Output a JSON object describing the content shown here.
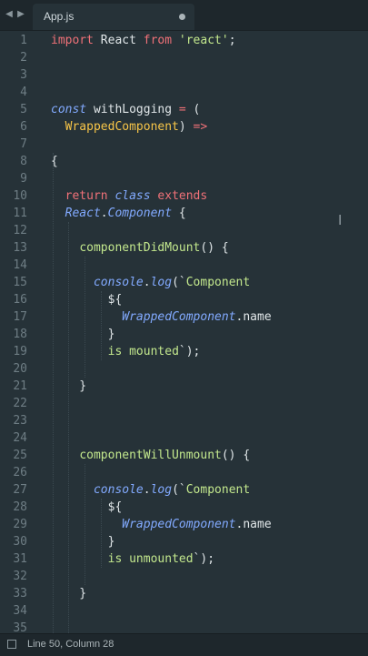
{
  "tabbar": {
    "back_icon": "triangle-left",
    "forward_icon": "triangle-right",
    "active_tab": {
      "label": "App.js",
      "modified_indicator": "dot"
    }
  },
  "editor": {
    "lines": [
      {
        "n": "1",
        "tokens": [
          {
            "t": "import",
            "c": "kw"
          },
          {
            "t": " React ",
            "c": "plain"
          },
          {
            "t": "from",
            "c": "kw"
          },
          {
            "t": " ",
            "c": "plain"
          },
          {
            "t": "'react'",
            "c": "str"
          },
          {
            "t": ";",
            "c": "punc"
          }
        ]
      },
      {
        "n": "2",
        "tokens": []
      },
      {
        "n": "3",
        "tokens": []
      },
      {
        "n": "4",
        "tokens": []
      },
      {
        "n": "5",
        "tokens": [
          {
            "t": "const",
            "c": "it"
          },
          {
            "t": " withLogging ",
            "c": "plain"
          },
          {
            "t": "=",
            "c": "op"
          },
          {
            "t": " (",
            "c": "punc"
          }
        ]
      },
      {
        "n": "6",
        "tokens": [
          {
            "t": "  ",
            "c": "plain"
          },
          {
            "t": "WrappedComponent",
            "c": "param"
          },
          {
            "t": ") ",
            "c": "punc"
          },
          {
            "t": "=>",
            "c": "op"
          }
        ]
      },
      {
        "n": "7",
        "tokens": []
      },
      {
        "n": "8",
        "tokens": [
          {
            "t": "{",
            "c": "punc"
          }
        ]
      },
      {
        "n": "9",
        "tokens": []
      },
      {
        "n": "10",
        "tokens": [
          {
            "t": "  ",
            "c": "plain"
          },
          {
            "t": "return",
            "c": "kw"
          },
          {
            "t": " ",
            "c": "plain"
          },
          {
            "t": "class",
            "c": "it"
          },
          {
            "t": " ",
            "c": "plain"
          },
          {
            "t": "extends",
            "c": "kw2"
          }
        ]
      },
      {
        "n": "11",
        "tokens": [
          {
            "t": "  ",
            "c": "plain"
          },
          {
            "t": "React",
            "c": "cls"
          },
          {
            "t": ".",
            "c": "punc"
          },
          {
            "t": "Component",
            "c": "cls"
          },
          {
            "t": " {",
            "c": "punc"
          }
        ]
      },
      {
        "n": "12",
        "tokens": []
      },
      {
        "n": "13",
        "tokens": [
          {
            "t": "    ",
            "c": "plain"
          },
          {
            "t": "componentDidMount",
            "c": "fn"
          },
          {
            "t": "() {",
            "c": "punc"
          }
        ]
      },
      {
        "n": "14",
        "tokens": []
      },
      {
        "n": "15",
        "tokens": [
          {
            "t": "      ",
            "c": "plain"
          },
          {
            "t": "console",
            "c": "it"
          },
          {
            "t": ".",
            "c": "punc"
          },
          {
            "t": "log",
            "c": "it"
          },
          {
            "t": "(`",
            "c": "punc"
          },
          {
            "t": "Component",
            "c": "tpl"
          }
        ]
      },
      {
        "n": "16",
        "tokens": [
          {
            "t": "        ${",
            "c": "plain"
          }
        ]
      },
      {
        "n": "17",
        "tokens": [
          {
            "t": "          ",
            "c": "plain"
          },
          {
            "t": "WrappedComponent",
            "c": "it"
          },
          {
            "t": ".name",
            "c": "plain"
          }
        ]
      },
      {
        "n": "18",
        "tokens": [
          {
            "t": "        }",
            "c": "plain"
          }
        ]
      },
      {
        "n": "19",
        "tokens": [
          {
            "t": "        ",
            "c": "plain"
          },
          {
            "t": "is mounted",
            "c": "tpl"
          },
          {
            "t": "`);",
            "c": "punc"
          }
        ]
      },
      {
        "n": "20",
        "tokens": []
      },
      {
        "n": "21",
        "tokens": [
          {
            "t": "    }",
            "c": "punc"
          }
        ]
      },
      {
        "n": "22",
        "tokens": []
      },
      {
        "n": "23",
        "tokens": []
      },
      {
        "n": "24",
        "tokens": []
      },
      {
        "n": "25",
        "tokens": [
          {
            "t": "    ",
            "c": "plain"
          },
          {
            "t": "componentWillUnmount",
            "c": "fn"
          },
          {
            "t": "() {",
            "c": "punc"
          }
        ]
      },
      {
        "n": "26",
        "tokens": []
      },
      {
        "n": "27",
        "tokens": [
          {
            "t": "      ",
            "c": "plain"
          },
          {
            "t": "console",
            "c": "it"
          },
          {
            "t": ".",
            "c": "punc"
          },
          {
            "t": "log",
            "c": "it"
          },
          {
            "t": "(`",
            "c": "punc"
          },
          {
            "t": "Component",
            "c": "tpl"
          }
        ]
      },
      {
        "n": "28",
        "tokens": [
          {
            "t": "        ${",
            "c": "plain"
          }
        ]
      },
      {
        "n": "29",
        "tokens": [
          {
            "t": "          ",
            "c": "plain"
          },
          {
            "t": "WrappedComponent",
            "c": "it"
          },
          {
            "t": ".name",
            "c": "plain"
          }
        ]
      },
      {
        "n": "30",
        "tokens": [
          {
            "t": "        }",
            "c": "plain"
          }
        ]
      },
      {
        "n": "31",
        "tokens": [
          {
            "t": "        ",
            "c": "plain"
          },
          {
            "t": "is unmounted",
            "c": "tpl"
          },
          {
            "t": "`);",
            "c": "punc"
          }
        ]
      },
      {
        "n": "32",
        "tokens": []
      },
      {
        "n": "33",
        "tokens": [
          {
            "t": "    }",
            "c": "punc"
          }
        ]
      },
      {
        "n": "34",
        "tokens": []
      },
      {
        "n": "35",
        "tokens": []
      }
    ]
  },
  "statusbar": {
    "panel_icon": "panel-toggle-icon",
    "position_text": "Line 50, Column 28"
  },
  "colors": {
    "background": "#263238",
    "chrome": "#1e272c",
    "keyword": "#f07178",
    "string": "#c3e88d",
    "italic_blue": "#82aaff",
    "parameter": "#f7c548",
    "line_number": "#6e7d84"
  }
}
